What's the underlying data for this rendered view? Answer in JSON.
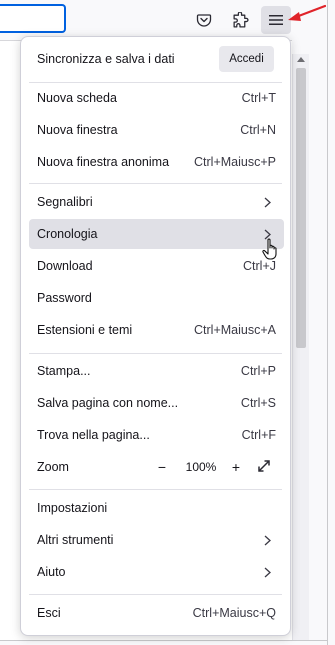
{
  "app": {
    "accent_color": "#0061e0",
    "annotation_arrow_color": "#e0242a"
  },
  "toolbar": {
    "url_box": "",
    "icons": [
      "pocket-icon",
      "extensions-icon",
      "hamburger-menu-icon"
    ]
  },
  "menu": {
    "header": {
      "title": "Sincronizza e salva i dati",
      "signin_label": "Accedi"
    },
    "items": {
      "new_tab": {
        "label": "Nuova scheda",
        "shortcut": "Ctrl+T"
      },
      "new_window": {
        "label": "Nuova finestra",
        "shortcut": "Ctrl+N"
      },
      "new_private": {
        "label": "Nuova finestra anonima",
        "shortcut": "Ctrl+Maiusc+P"
      },
      "bookmarks": {
        "label": "Segnalibri"
      },
      "history": {
        "label": "Cronologia"
      },
      "downloads": {
        "label": "Download",
        "shortcut": "Ctrl+J"
      },
      "passwords": {
        "label": "Password"
      },
      "addons": {
        "label": "Estensioni e temi",
        "shortcut": "Ctrl+Maiusc+A"
      },
      "print": {
        "label": "Stampa...",
        "shortcut": "Ctrl+P"
      },
      "save_page": {
        "label": "Salva pagina con nome...",
        "shortcut": "Ctrl+S"
      },
      "find": {
        "label": "Trova nella pagina...",
        "shortcut": "Ctrl+F"
      },
      "zoom": {
        "label": "Zoom",
        "minus": "−",
        "value": "100%",
        "plus": "+"
      },
      "settings": {
        "label": "Impostazioni"
      },
      "more_tools": {
        "label": "Altri strumenti"
      },
      "help": {
        "label": "Aiuto"
      },
      "quit": {
        "label": "Esci",
        "shortcut": "Ctrl+Maiusc+Q"
      }
    }
  }
}
